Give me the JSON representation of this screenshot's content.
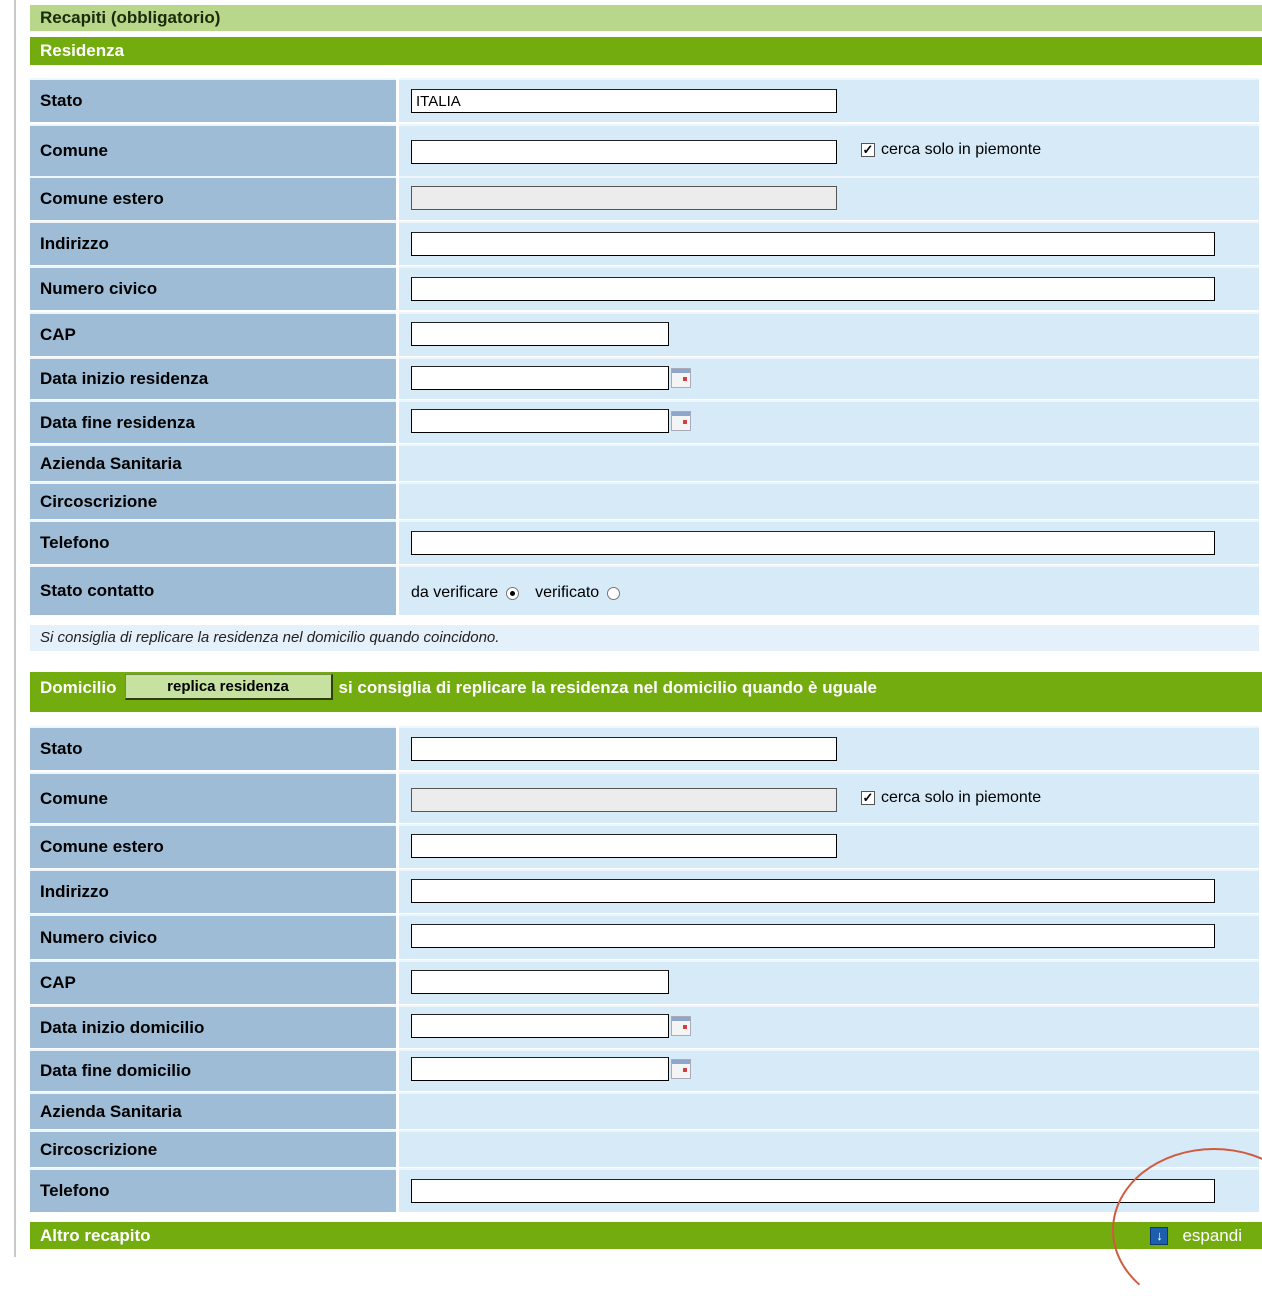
{
  "header": {
    "title": "Recapiti (obbligatorio)"
  },
  "residenza": {
    "title": "Residenza",
    "labels": {
      "stato": "Stato",
      "comune": "Comune",
      "comune_estero": "Comune estero",
      "indirizzo": "Indirizzo",
      "numero_civico": "Numero civico",
      "cap": "CAP",
      "data_inizio": "Data inizio residenza",
      "data_fine": "Data fine residenza",
      "azienda": "Azienda Sanitaria",
      "circoscrizione": "Circoscrizione",
      "telefono": "Telefono",
      "stato_contatto": "Stato contatto"
    },
    "values": {
      "stato": "ITALIA"
    },
    "checkbox_label": "cerca solo in piemonte",
    "radio_da_verificare": "da verificare",
    "radio_verificato": "verificato"
  },
  "note": "Si consiglia di replicare la residenza nel domicilio quando coincidono.",
  "domicilio": {
    "title": "Domicilio",
    "replica_button": "replica residenza",
    "hint": "si consiglia di replicare la residenza nel domicilio quando è uguale",
    "labels": {
      "stato": "Stato",
      "comune": "Comune",
      "comune_estero": "Comune estero",
      "indirizzo": "Indirizzo",
      "numero_civico": "Numero civico",
      "cap": "CAP",
      "data_inizio": "Data inizio domicilio",
      "data_fine": "Data fine domicilio",
      "azienda": "Azienda Sanitaria",
      "circoscrizione": "Circoscrizione",
      "telefono": "Telefono"
    },
    "checkbox_label": "cerca solo in piemonte"
  },
  "altro": {
    "title": "Altro recapito",
    "expand_label": "espandi",
    "expand_icon": "↓"
  }
}
